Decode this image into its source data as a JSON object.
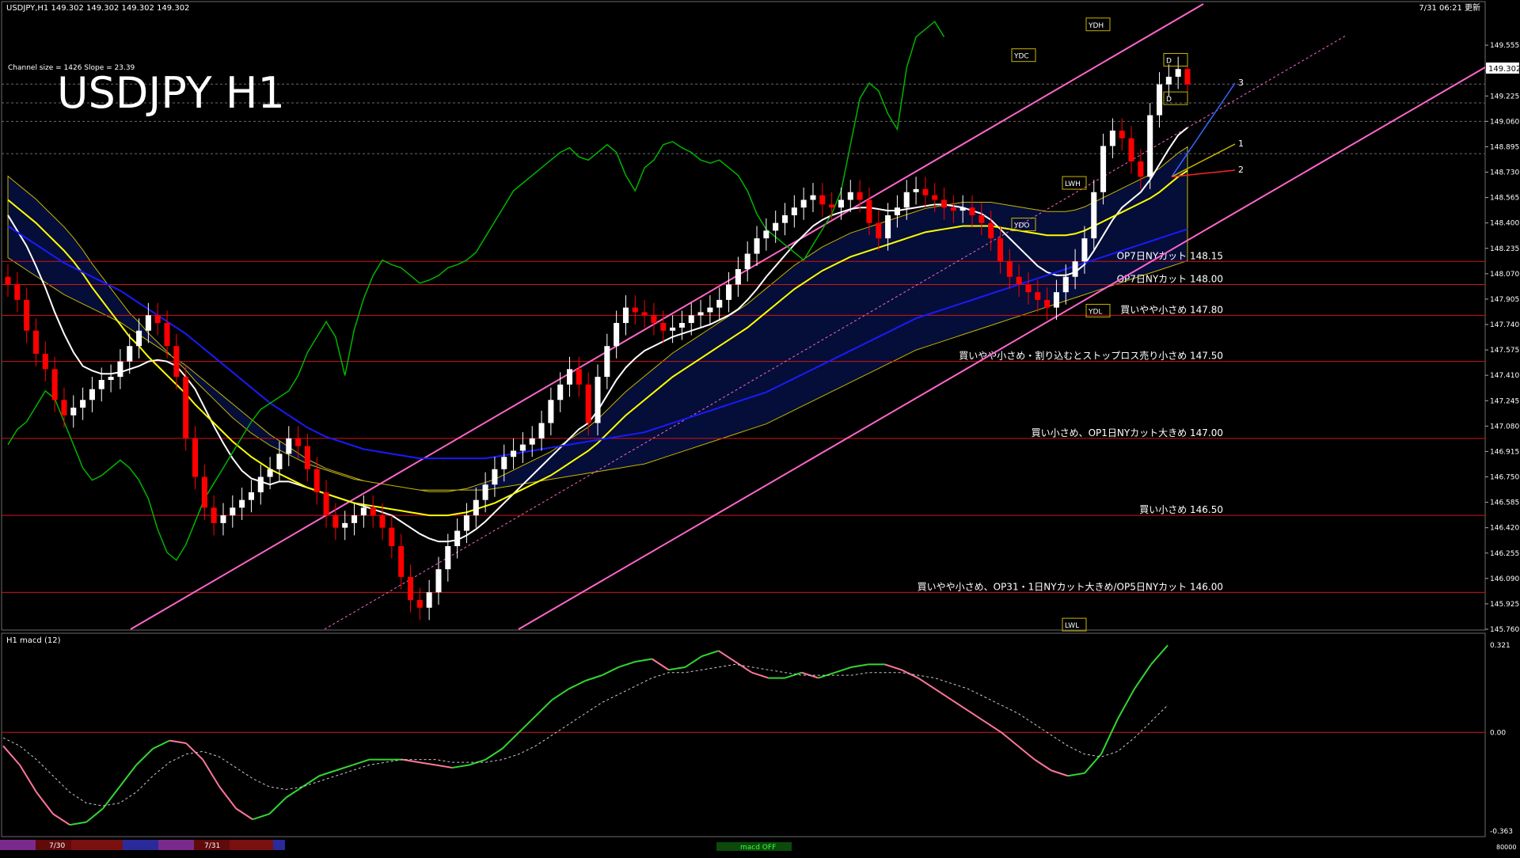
{
  "header": {
    "symbol_line": "USDJPY,H1  149.302 149.302 149.302 149.302",
    "timestamp": "7/31 06:21 更新",
    "channel_info": "Channel size = 1426 Slope = 23.39",
    "big_title": "USDJPY H1",
    "current_price": "149.302"
  },
  "colors": {
    "background": "#000000",
    "grid": "#6b6b6b",
    "bull_candle": "#ffffff",
    "bear_candle": "#ff0000",
    "channel": "#ff66cc",
    "ma_white": "#ffffff",
    "ma_yellow": "#ffff00",
    "ma_blue": "#1a1aff",
    "chikou": "#00b400",
    "level_line": "#d01515",
    "macd": "#33d633",
    "macd_neg": "#ff7799"
  },
  "chart_data": [
    {
      "type": "candlestick",
      "title": "USDJPY H1",
      "ylim": [
        145.76,
        149.72
      ],
      "y_ticks": [
        "149.555",
        "149.390",
        "149.225",
        "149.060",
        "148.895",
        "148.730",
        "148.565",
        "148.400",
        "148.235",
        "148.070",
        "147.905",
        "147.740",
        "147.575",
        "147.410",
        "147.245",
        "147.080",
        "146.915",
        "146.750",
        "146.585",
        "146.420",
        "146.255",
        "146.090",
        "145.925",
        "145.760"
      ],
      "y_tick_values": [
        149.555,
        149.39,
        149.225,
        149.06,
        148.895,
        148.73,
        148.565,
        148.4,
        148.235,
        148.07,
        147.905,
        147.74,
        147.575,
        147.41,
        147.245,
        147.08,
        146.915,
        146.75,
        146.585,
        146.42,
        146.255,
        146.09,
        145.925,
        145.76
      ],
      "close": [
        148.0,
        147.9,
        147.7,
        147.55,
        147.45,
        147.25,
        147.15,
        147.2,
        147.25,
        147.32,
        147.38,
        147.4,
        147.5,
        147.6,
        147.7,
        147.8,
        147.75,
        147.6,
        147.4,
        147.0,
        146.75,
        146.55,
        146.45,
        146.5,
        146.55,
        146.6,
        146.65,
        146.75,
        146.8,
        146.9,
        147.0,
        146.95,
        146.8,
        146.65,
        146.5,
        146.42,
        146.45,
        146.5,
        146.55,
        146.5,
        146.42,
        146.3,
        146.1,
        145.95,
        145.9,
        146.0,
        146.15,
        146.3,
        146.4,
        146.5,
        146.6,
        146.7,
        146.8,
        146.88,
        146.92,
        146.96,
        147.0,
        147.1,
        147.25,
        147.35,
        147.45,
        147.35,
        147.1,
        147.4,
        147.6,
        147.75,
        147.85,
        147.82,
        147.8,
        147.75,
        147.7,
        147.72,
        147.75,
        147.8,
        147.82,
        147.85,
        147.9,
        148.0,
        148.1,
        148.2,
        148.3,
        148.35,
        148.4,
        148.45,
        148.5,
        148.55,
        148.58,
        148.52,
        148.5,
        148.55,
        148.6,
        148.55,
        148.4,
        148.3,
        148.45,
        148.5,
        148.6,
        148.62,
        148.58,
        148.55,
        148.5,
        148.48,
        148.5,
        148.45,
        148.4,
        148.3,
        148.15,
        148.05,
        148.0,
        147.95,
        147.9,
        147.85,
        147.95,
        148.05,
        148.15,
        148.3,
        148.6,
        148.9,
        149.0,
        148.95,
        148.8,
        148.7,
        149.1,
        149.3,
        149.35,
        149.4,
        149.3
      ],
      "series": [
        {
          "name": "",
          "style": "ma_white",
          "values": [
            148.45,
            148.35,
            148.25,
            148.12,
            147.98,
            147.82,
            147.68,
            147.56,
            147.47,
            147.44,
            147.42,
            147.42,
            147.43,
            147.45,
            147.47,
            147.5,
            147.51,
            147.5,
            147.47,
            147.4,
            147.32,
            147.2,
            147.08,
            146.97,
            146.87,
            146.79,
            146.74,
            146.72,
            146.7,
            146.72,
            146.72,
            146.7,
            146.68,
            146.66,
            146.64,
            146.62,
            146.6,
            146.58,
            146.56,
            146.54,
            146.52,
            146.5,
            146.46,
            146.42,
            146.38,
            146.35,
            146.33,
            146.33,
            146.34,
            146.37,
            146.41,
            146.46,
            146.52,
            146.58,
            146.64,
            146.7,
            146.76,
            146.82,
            146.88,
            146.94,
            147.0,
            147.06,
            147.1,
            147.18,
            147.28,
            147.38,
            147.46,
            147.52,
            147.57,
            147.6,
            147.63,
            147.66,
            147.68,
            147.7,
            147.72,
            147.74,
            147.77,
            147.8,
            147.84,
            147.9,
            147.97,
            148.05,
            148.12,
            148.19,
            148.26,
            148.32,
            148.38,
            148.42,
            148.45,
            148.47,
            148.49,
            148.5,
            148.5,
            148.49,
            148.48,
            148.48,
            148.49,
            148.5,
            148.51,
            148.52,
            148.52,
            148.51,
            148.5,
            148.48,
            148.46,
            148.42,
            148.36,
            148.3,
            148.24,
            148.18,
            148.12,
            148.08,
            148.06,
            148.06,
            148.08,
            148.13,
            148.22,
            148.32,
            148.42,
            148.5,
            148.55,
            148.6,
            148.68,
            148.78,
            148.88,
            148.97,
            149.02
          ]
        },
        {
          "name": "",
          "style": "ma_yellow",
          "values": [
            148.55,
            148.5,
            148.45,
            148.4,
            148.34,
            148.28,
            148.22,
            148.15,
            148.07,
            147.98,
            147.9,
            147.82,
            147.74,
            147.66,
            147.6,
            147.53,
            147.47,
            147.41,
            147.35,
            147.29,
            147.22,
            147.16,
            147.1,
            147.04,
            146.98,
            146.93,
            146.88,
            146.84,
            146.8,
            146.77,
            146.74,
            146.71,
            146.68,
            146.66,
            146.64,
            146.62,
            146.6,
            146.58,
            146.57,
            146.56,
            146.55,
            146.54,
            146.53,
            146.52,
            146.51,
            146.5,
            146.5,
            146.5,
            146.51,
            146.52,
            146.54,
            146.56,
            146.58,
            146.61,
            146.64,
            146.67,
            146.7,
            146.73,
            146.76,
            146.8,
            146.84,
            146.88,
            146.92,
            146.97,
            147.03,
            147.09,
            147.15,
            147.2,
            147.25,
            147.3,
            147.35,
            147.4,
            147.44,
            147.48,
            147.52,
            147.56,
            147.6,
            147.64,
            147.68,
            147.72,
            147.77,
            147.82,
            147.87,
            147.92,
            147.97,
            148.01,
            148.05,
            148.09,
            148.12,
            148.15,
            148.18,
            148.2,
            148.22,
            148.24,
            148.26,
            148.28,
            148.3,
            148.32,
            148.34,
            148.35,
            148.36,
            148.37,
            148.38,
            148.38,
            148.38,
            148.38,
            148.37,
            148.36,
            148.35,
            148.34,
            148.33,
            148.32,
            148.32,
            148.32,
            148.33,
            148.35,
            148.38,
            148.41,
            148.44,
            148.47,
            148.5,
            148.53,
            148.56,
            148.6,
            148.65,
            148.7,
            148.74
          ]
        },
        {
          "name": "",
          "style": "ma_blue",
          "values": [
            148.38,
            148.34,
            148.3,
            148.26,
            148.22,
            148.18,
            148.14,
            148.11,
            148.08,
            148.05,
            148.02,
            147.99,
            147.96,
            147.92,
            147.88,
            147.84,
            147.8,
            147.76,
            147.72,
            147.68,
            147.63,
            147.58,
            147.53,
            147.48,
            147.43,
            147.38,
            147.33,
            147.28,
            147.23,
            147.19,
            147.15,
            147.11,
            147.07,
            147.04,
            147.01,
            146.99,
            146.97,
            146.95,
            146.93,
            146.92,
            146.91,
            146.9,
            146.89,
            146.88,
            146.87,
            146.87,
            146.87,
            146.87,
            146.87,
            146.87,
            146.87,
            146.87,
            146.88,
            146.89,
            146.9,
            146.91,
            146.92,
            146.93,
            146.94,
            146.95,
            146.96,
            146.97,
            146.98,
            146.99,
            147.0,
            147.01,
            147.02,
            147.03,
            147.04,
            147.06,
            147.08,
            147.1,
            147.12,
            147.14,
            147.16,
            147.18,
            147.2,
            147.22,
            147.24,
            147.26,
            147.28,
            147.3,
            147.33,
            147.36,
            147.39,
            147.42,
            147.45,
            147.48,
            147.51,
            147.54,
            147.57,
            147.6,
            147.63,
            147.66,
            147.69,
            147.72,
            147.75,
            147.78,
            147.8,
            147.82,
            147.84,
            147.86,
            147.88,
            147.9,
            147.92,
            147.94,
            147.96,
            147.98,
            148.0,
            148.02,
            148.04,
            148.06,
            148.08,
            148.1,
            148.12,
            148.14,
            148.16,
            148.18,
            148.2,
            148.22,
            148.24,
            148.26,
            148.28,
            148.3,
            148.32,
            148.34,
            148.36
          ]
        }
      ],
      "levels": [
        {
          "label": "OP7日NYカット 148.15",
          "value": 148.15
        },
        {
          "label": "OP7日NYカット 148.00",
          "value": 148.0
        },
        {
          "label": "買いやや小さめ 147.80",
          "value": 147.8
        },
        {
          "label": "買いやや小さめ・割り込むとストップロス売り小さめ 147.50",
          "value": 147.5
        },
        {
          "label": "買い小さめ、OP1日NYカット大きめ 147.00",
          "value": 147.0
        },
        {
          "label": "買い小さめ 146.50",
          "value": 146.5
        },
        {
          "label": "買いやや小さめ、OP31・1日NYカット大きめ/OP5日NYカット 146.00",
          "value": 146.0
        }
      ],
      "reference_labels": [
        {
          "label": "YDH",
          "value": 149.68
        },
        {
          "label": "YDC",
          "value": 149.48
        },
        {
          "label": "LWH",
          "value": 148.65
        },
        {
          "label": "YDO",
          "value": 148.38
        },
        {
          "label": "YDL",
          "value": 147.82
        },
        {
          "label": "LWL",
          "value": 145.78
        },
        {
          "label": "D",
          "value": 149.45
        },
        {
          "label": "D",
          "value": 149.2
        }
      ],
      "projection_labels": [
        "3",
        "1",
        "2"
      ]
    },
    {
      "type": "line",
      "title": "H1  macd (12)",
      "ylim": [
        -0.363,
        0.321
      ],
      "y_ticks": [
        "0.321",
        "0.00",
        "-0.363"
      ],
      "y_tick_values": [
        0.321,
        0.0,
        -0.363
      ],
      "series": [
        {
          "name": "",
          "style": "macd",
          "values": [
            -0.05,
            -0.12,
            -0.22,
            -0.3,
            -0.34,
            -0.33,
            -0.28,
            -0.2,
            -0.12,
            -0.06,
            -0.03,
            -0.04,
            -0.1,
            -0.2,
            -0.28,
            -0.32,
            -0.3,
            -0.24,
            -0.2,
            -0.16,
            -0.14,
            -0.12,
            -0.1,
            -0.1,
            -0.1,
            -0.11,
            -0.12,
            -0.13,
            -0.12,
            -0.1,
            -0.06,
            0.0,
            0.06,
            0.12,
            0.16,
            0.19,
            0.21,
            0.24,
            0.26,
            0.27,
            0.23,
            0.24,
            0.28,
            0.3,
            0.26,
            0.22,
            0.2,
            0.2,
            0.22,
            0.2,
            0.22,
            0.24,
            0.25,
            0.25,
            0.23,
            0.2,
            0.16,
            0.12,
            0.08,
            0.04,
            0.0,
            -0.05,
            -0.1,
            -0.14,
            -0.16,
            -0.15,
            -0.08,
            0.05,
            0.16,
            0.25,
            0.32
          ]
        },
        {
          "name": "",
          "style": "signal",
          "values": [
            -0.02,
            -0.05,
            -0.1,
            -0.16,
            -0.22,
            -0.26,
            -0.27,
            -0.26,
            -0.22,
            -0.16,
            -0.11,
            -0.08,
            -0.07,
            -0.09,
            -0.13,
            -0.17,
            -0.2,
            -0.21,
            -0.2,
            -0.18,
            -0.16,
            -0.14,
            -0.12,
            -0.11,
            -0.1,
            -0.1,
            -0.1,
            -0.11,
            -0.11,
            -0.11,
            -0.1,
            -0.08,
            -0.05,
            -0.01,
            0.03,
            0.07,
            0.11,
            0.14,
            0.17,
            0.2,
            0.22,
            0.22,
            0.23,
            0.24,
            0.25,
            0.24,
            0.23,
            0.22,
            0.21,
            0.21,
            0.21,
            0.21,
            0.22,
            0.22,
            0.22,
            0.21,
            0.2,
            0.18,
            0.16,
            0.13,
            0.1,
            0.07,
            0.03,
            -0.01,
            -0.05,
            -0.08,
            -0.09,
            -0.07,
            -0.02,
            0.04,
            0.1
          ]
        }
      ]
    }
  ],
  "bottom_bar": {
    "date_labels": [
      "7/30",
      "7/31"
    ],
    "indicator_label": "macd OFF",
    "volume_label": "80000"
  }
}
